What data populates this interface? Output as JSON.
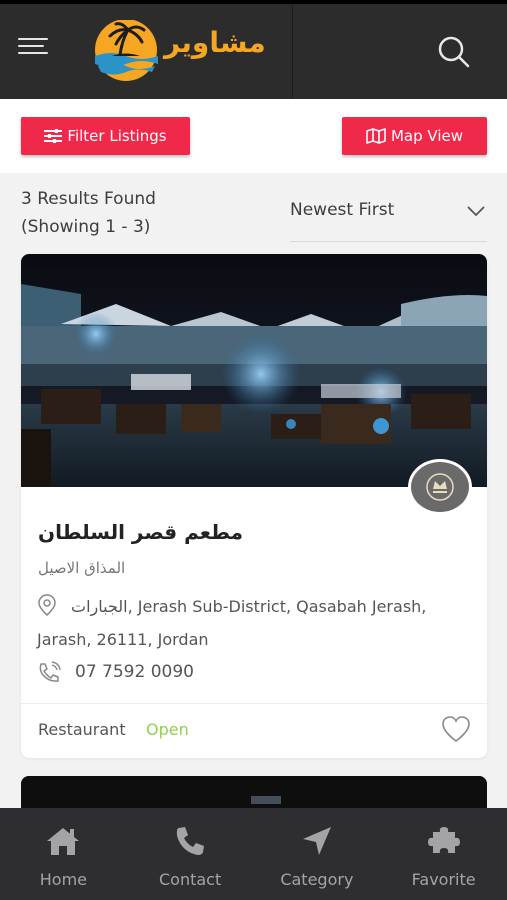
{
  "header": {
    "brand_name": "مشاوير",
    "menu_icon": "hamburger-icon",
    "search_icon": "search-icon"
  },
  "toolbar": {
    "filter_label": "Filter Listings",
    "map_label": "Map View"
  },
  "results": {
    "count_line1": "3 Results Found",
    "count_line2": "(Showing 1 - 3)",
    "sort_value": "Newest First"
  },
  "listings": [
    {
      "title": "مطعم قصر السلطان",
      "subtitle": "المذاق الاصيل",
      "address": "الجبارات, Jerash Sub-District, Qasabah Jerash, Jarash, 26111, Jordan",
      "phone": "07 7592 0090",
      "category": "Restaurant",
      "status": "Open"
    }
  ],
  "bottom_nav": {
    "items": [
      {
        "label": "Home",
        "icon": "home-icon"
      },
      {
        "label": "Contact",
        "icon": "phone-icon"
      },
      {
        "label": "Category",
        "icon": "navigation-arrow-icon"
      },
      {
        "label": "Favorite",
        "icon": "puzzle-icon"
      }
    ]
  },
  "colors": {
    "accent": "#f0284a",
    "header_bg": "#2c2c2c",
    "brand": "#f5a623",
    "status_open": "#8fd14f",
    "nav_bg": "#2e2e32"
  }
}
